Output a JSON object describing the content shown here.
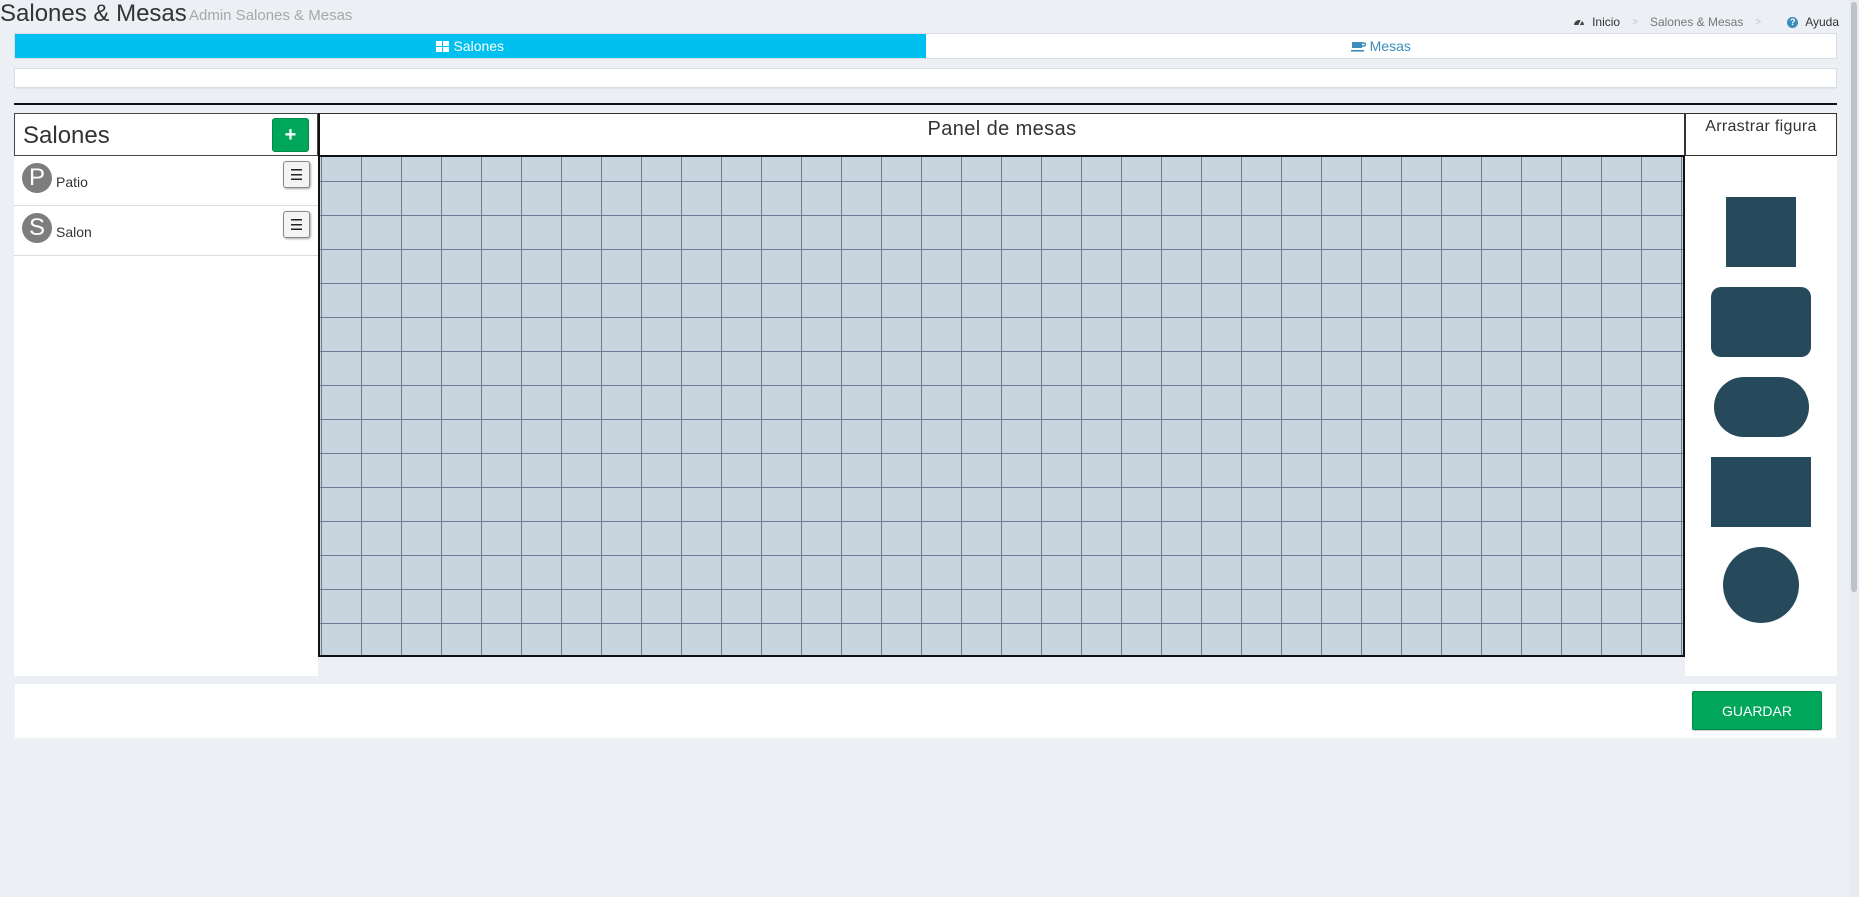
{
  "header": {
    "title": "Salones & Mesas",
    "subtitle": "Admin Salones & Mesas"
  },
  "breadcrumb": {
    "home_icon": "dashboard-icon",
    "home": "Inicio",
    "current": "Salones & Mesas",
    "help_icon": "question-circle-icon",
    "help": "Ayuda"
  },
  "tabs": [
    {
      "label": "Salones",
      "icon": "grid-icon",
      "active": true
    },
    {
      "label": "Mesas",
      "icon": "coffee-icon",
      "active": false
    }
  ],
  "sidebar": {
    "title": "Salones",
    "add_label": "+",
    "items": [
      {
        "initial": "P",
        "label": "Patio",
        "menu_icon": "hamburger-icon"
      },
      {
        "initial": "S",
        "label": "Salon",
        "menu_icon": "hamburger-icon"
      }
    ]
  },
  "panel": {
    "title": "Panel de mesas"
  },
  "shapes": {
    "title": "Arrastrar figura",
    "items": [
      "square-table",
      "rounded-rect-table",
      "pill-table",
      "rect-table",
      "circle-table"
    ]
  },
  "footer": {
    "save_label": "GUARDAR"
  },
  "colors": {
    "tab_active": "#00c0ef",
    "success": "#00a65a",
    "link": "#3c8dbc",
    "grid_fill": "#c8d5de",
    "grid_line": "#6c7a93",
    "shape_fill": "#264a5c",
    "avatar": "#7d7d7d"
  }
}
